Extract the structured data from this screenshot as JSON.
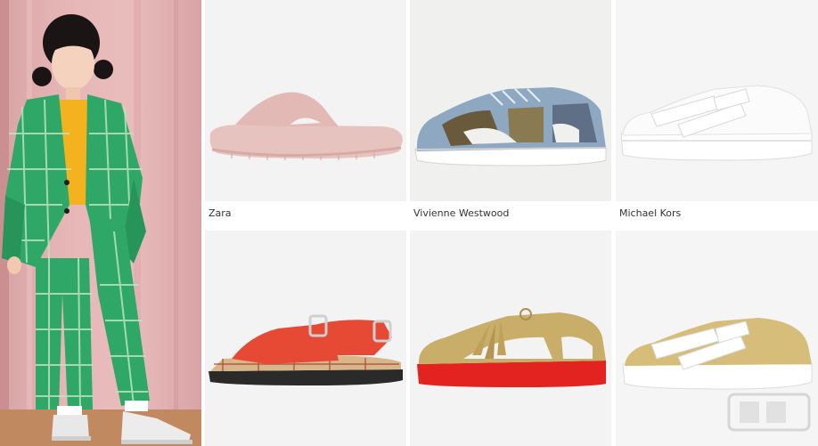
{
  "products": [
    {
      "brand": "Zara",
      "item_icon": "pink-slide-sandal-icon"
    },
    {
      "brand": "Vivienne Westwood",
      "item_icon": "denim-cutout-sneaker-icon"
    },
    {
      "brand": "Michael Kors",
      "item_icon": "white-strap-sneaker-icon"
    },
    {
      "item_icon": "red-buckle-sandal-icon"
    },
    {
      "item_icon": "gold-tassel-cutout-sneaker-icon"
    },
    {
      "item_icon": "white-gold-strap-sneaker-icon"
    }
  ],
  "hero": {
    "icon": "child-in-green-plaid-suit-photo"
  },
  "colors": {
    "hero_background": "#e7b7b7",
    "plaid_green": "#2fa867",
    "shirt_yellow": "#f4b21f",
    "slide_pink": "#e7c3c0",
    "sandal_red": "#e64a35",
    "sole_red": "#e2231f",
    "gold": "#c9ae6a"
  }
}
